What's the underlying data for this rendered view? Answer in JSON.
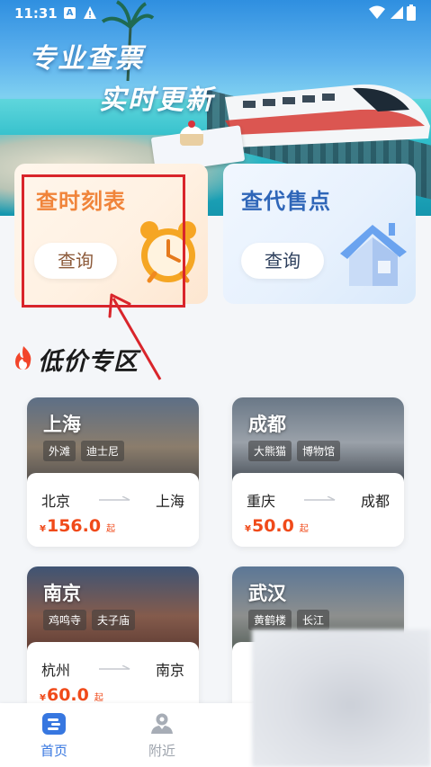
{
  "status_bar": {
    "time": "11:31",
    "notification_badge": "A",
    "icons": [
      "warning-icon",
      "wifi-icon",
      "signal-icon",
      "battery-icon"
    ]
  },
  "hero": {
    "slogan_line1": "专业查票",
    "slogan_line2": "实时更新"
  },
  "features": [
    {
      "title": "查时刻表",
      "button": "查询",
      "icon": "alarm-clock-icon",
      "color": "#f0843a"
    },
    {
      "title": "查代售点",
      "button": "查询",
      "icon": "house-icon",
      "color": "#2f66b8"
    }
  ],
  "section": {
    "title": "低价专区",
    "icon": "flame-icon"
  },
  "routes": [
    {
      "city": "上海",
      "tags": [
        "外滩",
        "迪士尼"
      ],
      "from": "北京",
      "to": "上海",
      "currency": "¥",
      "price": "156.0",
      "suffix": "起"
    },
    {
      "city": "成都",
      "tags": [
        "大熊猫",
        "博物馆"
      ],
      "from": "重庆",
      "to": "成都",
      "currency": "¥",
      "price": "50.0",
      "suffix": "起"
    },
    {
      "city": "南京",
      "tags": [
        "鸡鸣寺",
        "夫子庙"
      ],
      "from": "杭州",
      "to": "南京",
      "currency": "¥",
      "price": "60.0",
      "suffix": "起"
    },
    {
      "city": "武汉",
      "tags": [
        "黄鹤楼",
        "长江"
      ],
      "from": "",
      "to": "",
      "currency": "",
      "price": "",
      "suffix": ""
    }
  ],
  "bottom_nav": [
    {
      "label": "首页",
      "icon": "home-icon",
      "active": true
    },
    {
      "label": "附近",
      "icon": "location-person-icon",
      "active": false
    }
  ],
  "colors": {
    "accent_blue": "#3777e0",
    "price_red": "#f04a1a",
    "annotation_red": "#d9252b"
  }
}
